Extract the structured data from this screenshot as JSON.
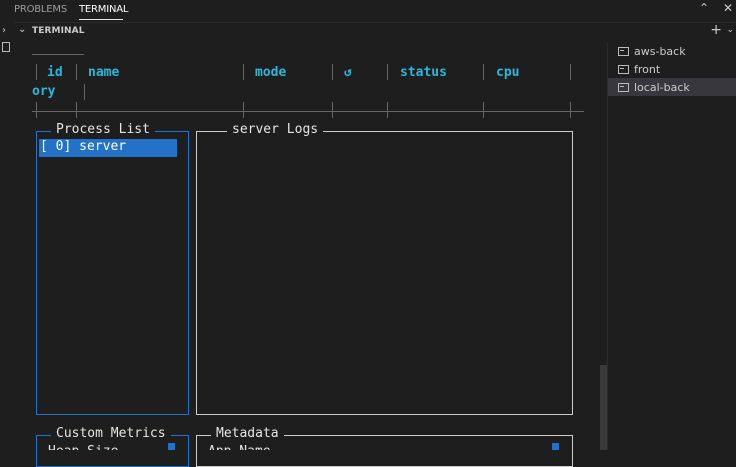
{
  "tabs": {
    "problems": "PROBLEMS",
    "terminal": "TERMINAL"
  },
  "panel": {
    "title": "TERMINAL"
  },
  "table": {
    "headers": [
      "id",
      "name",
      "mode",
      "↺",
      "status",
      "cpu"
    ],
    "wrap_text": "ory"
  },
  "process_list": {
    "title": "Process List",
    "items": [
      "[ 0] server"
    ]
  },
  "logs": {
    "title": "server Logs"
  },
  "custom_metrics": {
    "title": "Custom Metrics",
    "partial_text": "Heap Size"
  },
  "metadata": {
    "title": "Metadata",
    "partial_text": "App Name"
  },
  "terminals": [
    "aws-back",
    "front",
    "local-back"
  ],
  "colors": {
    "accent": "#2472c8",
    "header": "#29b8db",
    "selected": "#37373d"
  }
}
